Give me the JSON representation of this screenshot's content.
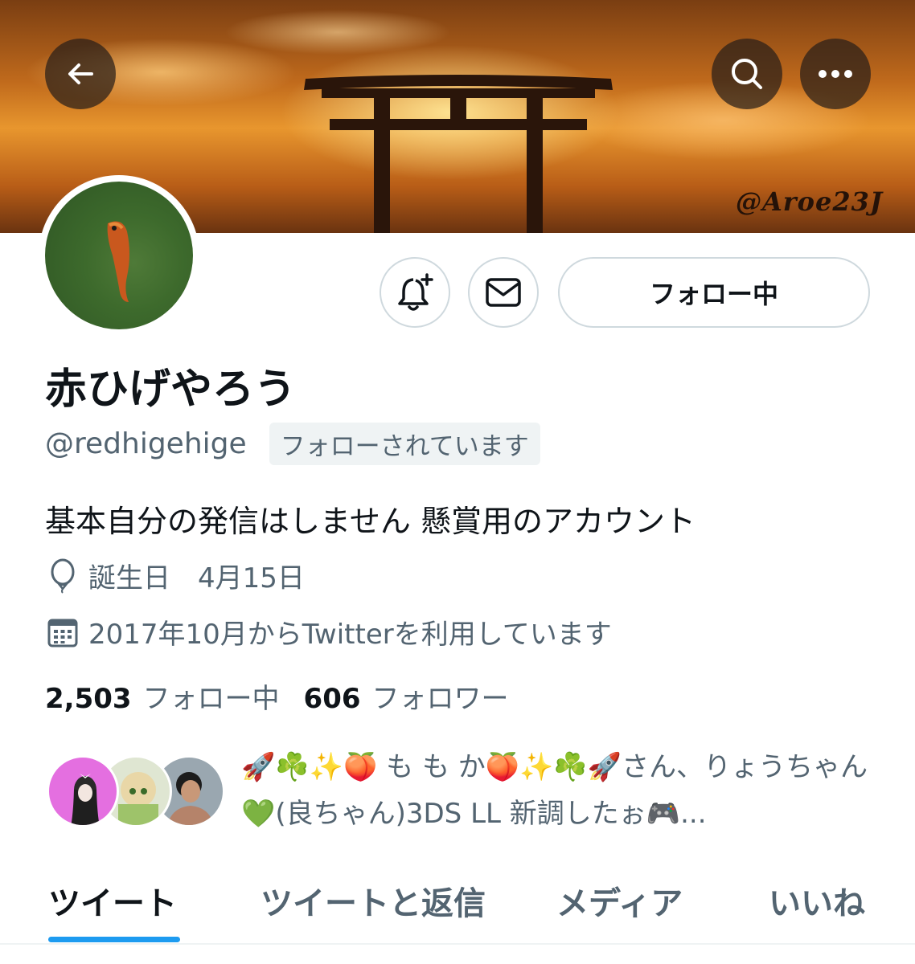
{
  "header": {
    "banner_watermark": "@Aroe23J",
    "back_icon": "arrow-left-icon",
    "search_icon": "search-icon",
    "more_icon": "ellipsis-icon"
  },
  "actions": {
    "notify_icon": "bell-plus-icon",
    "message_icon": "envelope-icon",
    "follow_label": "フォロー中"
  },
  "profile": {
    "name": "赤ひげやろう",
    "handle": "@redhigehige",
    "follows_you": "フォローされています",
    "bio": "基本自分の発信はしません 懸賞用のアカウント",
    "birthday_label": "誕生日　4月15日",
    "joined": "2017年10月からTwitterを利用しています"
  },
  "stats": {
    "following_count": "2,503",
    "following_label": "フォロー中",
    "followers_count": "606",
    "followers_label": "フォロワー"
  },
  "known_followers": {
    "text": "🚀☘️✨🍑 も も か🍑✨☘️🚀さん、りょうちゃん💚(良ちゃん)3DS LL 新調したぉ🎮..."
  },
  "tabs": [
    {
      "label": "ツイート",
      "active": true
    },
    {
      "label": "ツイートと返信",
      "active": false
    },
    {
      "label": "メディア",
      "active": false
    },
    {
      "label": "いいね",
      "active": false
    }
  ],
  "colors": {
    "accent": "#1d9bf0",
    "secondary_text": "#536471",
    "primary_text": "#0f1419"
  }
}
